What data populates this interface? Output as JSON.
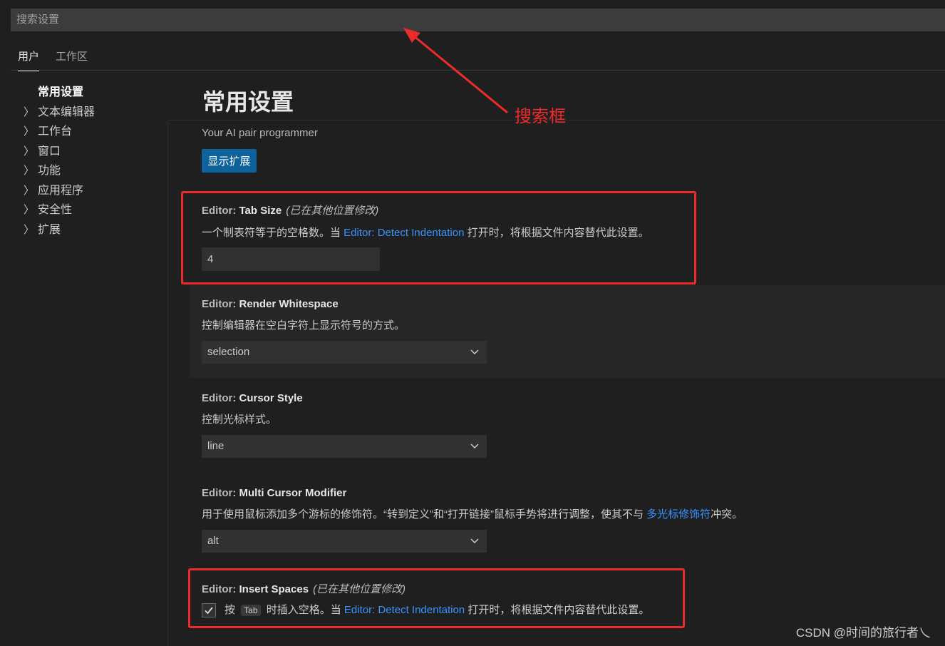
{
  "search": {
    "placeholder": "搜索设置"
  },
  "tabs": [
    {
      "label": "用户"
    },
    {
      "label": "工作区"
    }
  ],
  "toc": {
    "selected": "常用设置",
    "items": [
      "文本编辑器",
      "工作台",
      "窗口",
      "功能",
      "应用程序",
      "安全性",
      "扩展"
    ]
  },
  "page": {
    "title": "常用设置",
    "subtitle": "Your AI pair programmer",
    "show_extensions_label": "显示扩展"
  },
  "settings": {
    "tab_size": {
      "category": "Editor: ",
      "name": "Tab Size",
      "modified": "(已在其他位置修改)",
      "desc_before": "一个制表符等于的空格数。当 ",
      "link": "Editor: Detect Indentation",
      "desc_after": " 打开时，将根据文件内容替代此设置。",
      "value": "4"
    },
    "render_whitespace": {
      "category": "Editor: ",
      "name": "Render Whitespace",
      "desc": "控制编辑器在空白字符上显示符号的方式。",
      "value": "selection"
    },
    "cursor_style": {
      "category": "Editor: ",
      "name": "Cursor Style",
      "desc": "控制光标样式。",
      "value": "line"
    },
    "multi_cursor": {
      "category": "Editor: ",
      "name": "Multi Cursor Modifier",
      "desc_before": "用于使用鼠标添加多个游标的修饰符。“转到定义”和“打开链接”鼠标手势将进行调整，使其不与 ",
      "link": "多光标修饰符",
      "desc_after": "冲突。",
      "value": "alt"
    },
    "insert_spaces": {
      "category": "Editor: ",
      "name": "Insert Spaces",
      "modified": "(已在其他位置修改)",
      "desc_before": "按 ",
      "kbd": "Tab",
      "desc_mid": " 时插入空格。当 ",
      "link": "Editor: Detect Indentation",
      "desc_after": " 打开时，将根据文件内容替代此设置。",
      "checked": true
    }
  },
  "annotation": {
    "label": "搜索框",
    "color": "#ec2b2b"
  },
  "watermark": "CSDN @时间的旅行者乀",
  "colors": {
    "accent": "#0e639c",
    "link": "#3794ff",
    "background": "#1f1f1f"
  },
  "icons": {
    "toc_chevron": "chevron-right-icon",
    "select_chevron": "chevron-down-icon",
    "checkbox": "check-icon"
  }
}
